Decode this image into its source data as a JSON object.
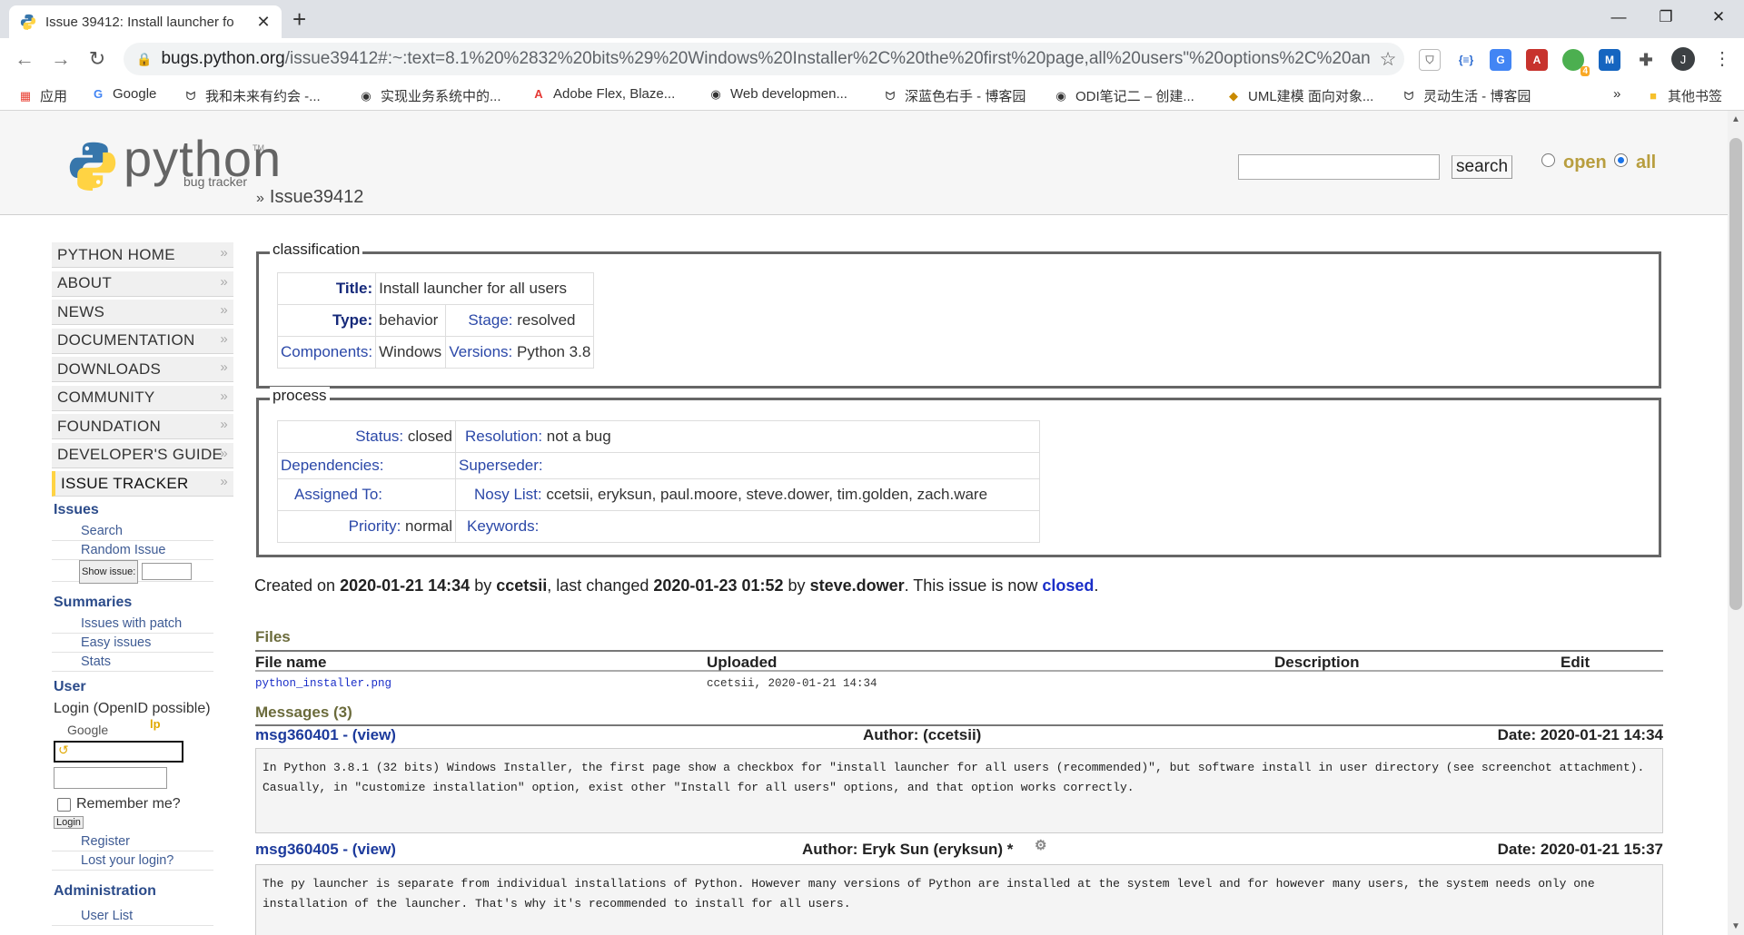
{
  "browser": {
    "tab_title": "Issue 39412: Install launcher fo",
    "url_host": "bugs.python.org",
    "url_rest": "/issue39412#:~:text=8.1%20%2832%20bits%29%20Windows%20Installer%2C%20the%20first%20page,all%20users\"%20options%2C%20an...",
    "profile_initial": "J",
    "ext_badge": "4",
    "bookmarks": [
      "应用",
      "Google",
      "我和未来有约会 -...",
      "实现业务系统中的...",
      "Adobe Flex, Blaze...",
      "Web developmen...",
      "深蓝色右手 - 博客园",
      "ODI笔记二 – 创建...",
      "UML建模 面向对象...",
      "灵动生活 - 博客园"
    ],
    "bookmarks_more": "»",
    "other_bookmarks": "其他书签"
  },
  "header": {
    "logo_word": "python",
    "logo_tm": "TM",
    "logo_sub": "bug tracker",
    "breadcrumb_sep": "»",
    "breadcrumb": "Issue39412",
    "search_button": "search",
    "radio_open": "open",
    "radio_all": "all"
  },
  "sidebar": {
    "menu": [
      "PYTHON HOME",
      "ABOUT",
      "NEWS",
      "DOCUMENTATION",
      "DOWNLOADS",
      "COMMUNITY",
      "FOUNDATION",
      "DEVELOPER'S GUIDE",
      "ISSUE TRACKER"
    ],
    "issues_title": "Issues",
    "issues_links": [
      "Search",
      "Random Issue"
    ],
    "show_issue_button": "Show issue:",
    "summaries_title": "Summaries",
    "summaries_links": [
      "Issues with patch",
      "Easy issues",
      "Stats"
    ],
    "user_title": "User",
    "login_openid": "Login (OpenID possible)",
    "google_alt": "Google",
    "lp_label": "lp",
    "remember_me": "Remember me?",
    "login_button": "Login",
    "register": "Register",
    "lost_login": "Lost your login?",
    "admin_title": "Administration",
    "user_list": "User List"
  },
  "classification": {
    "legend": "classification",
    "title_label": "Title:",
    "title_value": "Install launcher for all users",
    "type_label": "Type:",
    "type_value": "behavior",
    "stage_label": "Stage:",
    "stage_value": "resolved",
    "components_label": "Components:",
    "components_value": "Windows",
    "versions_label": "Versions:",
    "versions_value": "Python 3.8"
  },
  "process": {
    "legend": "process",
    "status_label": "Status:",
    "status_value": "closed",
    "resolution_label": "Resolution:",
    "resolution_value": "not a bug",
    "dependencies_label": "Dependencies:",
    "dependencies_value": "",
    "superseder_label": "Superseder:",
    "superseder_value": "",
    "assigned_label": "Assigned To:",
    "assigned_value": "",
    "nosy_label": "Nosy List:",
    "nosy_value": "ccetsii, eryksun, paul.moore, steve.dower, tim.golden, zach.ware",
    "priority_label": "Priority:",
    "priority_value": "normal",
    "keywords_label": "Keywords:",
    "keywords_value": ""
  },
  "created": {
    "prefix": "Created on",
    "created_date": "2020-01-21 14:34",
    "by1": "by",
    "creator": "ccetsii",
    "changed_text": ", last changed",
    "changed_date": "2020-01-23 01:52",
    "by2": "by",
    "changer": "steve.dower",
    "now_text": ". This issue is now",
    "state": "closed",
    "end": "."
  },
  "files": {
    "title": "Files",
    "headers": [
      "File name",
      "Uploaded",
      "Description",
      "Edit"
    ],
    "rows": [
      {
        "name": "python_installer.png",
        "uploaded": "ccetsii, 2020-01-21 14:34",
        "description": "",
        "edit": ""
      }
    ]
  },
  "messages": {
    "title": "Messages (3)",
    "items": [
      {
        "id": "msg360401 - (view)",
        "author": "Author: (ccetsii)",
        "date": "Date: 2020-01-21 14:34",
        "body": "In Python 3.8.1 (32 bits) Windows Installer, the first page show a checkbox for \"install launcher for all users (recommended)\", but software install in user directory (see screenchot attachment).\nCasually, in \"customize installation\" option, exist other \"Install for all users\" options, and that option works correctly."
      },
      {
        "id": "msg360405 - (view)",
        "author": "Author: Eryk Sun (eryksun) *",
        "date": "Date: 2020-01-21 15:37",
        "body": "The py launcher is separate from individual installations of Python. However many versions of Python are installed at the system level and for however many users, the system needs only one installation of the launcher. That's why it's recommended to install for all users."
      }
    ]
  },
  "colors": {
    "accent_yellow": "#ffd343",
    "link_blue": "#2b48a8",
    "section_olive": "#6b6b3b"
  }
}
